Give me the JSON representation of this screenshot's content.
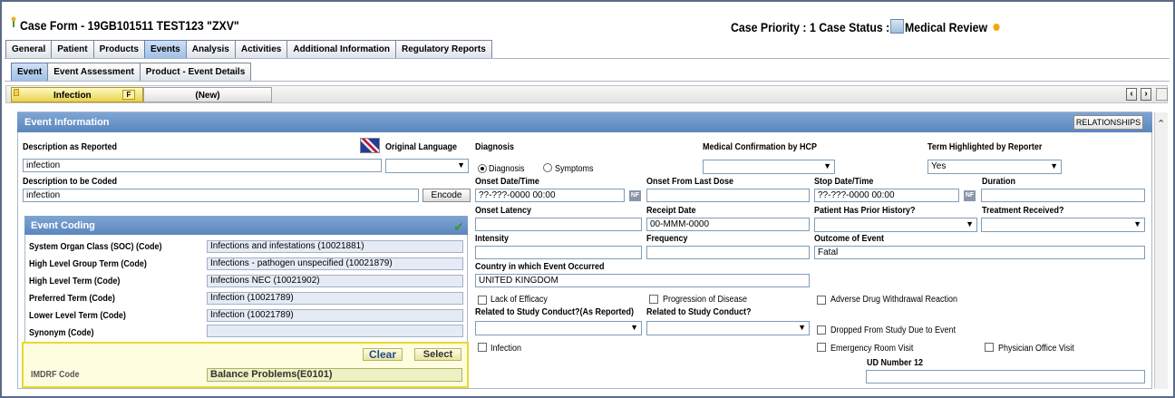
{
  "title": "Case Form - 19GB101511 TEST123 \"ZXV\"",
  "priority_status": "Case Priority : 1 Case Status :",
  "status_value": "Medical Review",
  "main_tabs": [
    "General",
    "Patient",
    "Products",
    "Events",
    "Analysis",
    "Activities",
    "Additional Information",
    "Regulatory Reports"
  ],
  "sub_tabs": [
    "Event",
    "Event Assessment",
    "Product - Event Details"
  ],
  "event_tabs": {
    "infection": "Infection",
    "badge": "F",
    "new": "(New)"
  },
  "panel": {
    "title": "Event Information",
    "relationships": "RELATIONSHIPS"
  },
  "fields": {
    "desc_reported_label": "Description as Reported",
    "desc_reported_value": "infection",
    "orig_lang_label": "Original Language",
    "desc_coded_label": "Description to be Coded",
    "desc_coded_value": "infection",
    "encode": "Encode",
    "diagnosis_label": "Diagnosis",
    "diagnosis_radio": "Diagnosis",
    "symptoms_radio": "Symptoms",
    "med_conf_label": "Medical Confirmation by HCP",
    "term_high_label": "Term Highlighted by Reporter",
    "term_high_value": "Yes",
    "onset_dt_label": "Onset Date/Time",
    "onset_dt_value": "??-???-0000 00:00",
    "nf": "NF",
    "onset_last_dose_label": "Onset From Last Dose",
    "stop_dt_label": "Stop Date/Time",
    "stop_dt_value": "??-???-0000 00:00",
    "duration_label": "Duration",
    "onset_latency_label": "Onset Latency",
    "receipt_date_label": "Receipt Date",
    "receipt_date_value": "00-MMM-0000",
    "prior_history_label": "Patient Has Prior History?",
    "treatment_label": "Treatment Received?",
    "intensity_label": "Intensity",
    "frequency_label": "Frequency",
    "outcome_label": "Outcome of Event",
    "outcome_value": "Fatal",
    "country_label": "Country in which Event Occurred",
    "country_value": "UNITED KINGDOM",
    "lack_efficacy": "Lack of Efficacy",
    "progression": "Progression of Disease",
    "adverse_withdrawal": "Adverse Drug Withdrawal Reaction",
    "related_reported_label": "Related to Study Conduct?(As Reported)",
    "related_label": "Related to Study Conduct?",
    "dropped": "Dropped From Study Due to Event",
    "infection": "Infection",
    "er_visit": "Emergency Room Visit",
    "physician_visit": "Physician Office Visit",
    "ud12_label": "UD Number 12"
  },
  "coding": {
    "title": "Event Coding",
    "rows": [
      {
        "label": "System Organ Class (SOC) (Code)",
        "value": "Infections and infestations (10021881)"
      },
      {
        "label": "High Level Group Term (Code)",
        "value": "Infections - pathogen unspecified (10021879)"
      },
      {
        "label": "High Level Term (Code)",
        "value": "Infections NEC (10021902)"
      },
      {
        "label": "Preferred Term (Code)",
        "value": "Infection (10021789)"
      },
      {
        "label": "Lower Level Term (Code)",
        "value": "Infection (10021789)"
      },
      {
        "label": "Synonym (Code)",
        "value": ""
      }
    ]
  },
  "imdrf": {
    "clear": "Clear",
    "select": "Select",
    "label": "IMDRF Code",
    "value": "Balance Problems(E0101)"
  }
}
